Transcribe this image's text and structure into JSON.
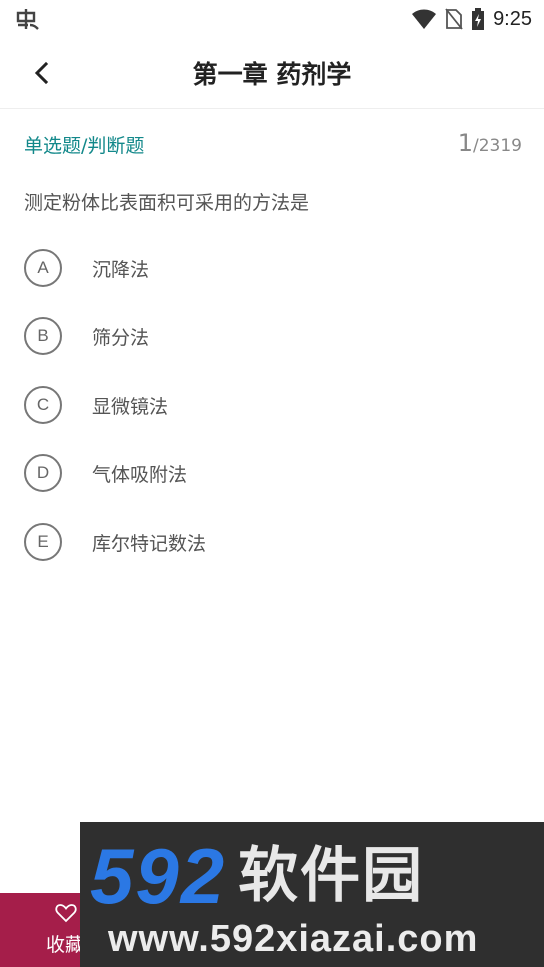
{
  "status_bar": {
    "time": "9:25",
    "icons": [
      "app-notification-icon",
      "wifi-icon",
      "no-sim-icon",
      "battery-charging-icon"
    ]
  },
  "header": {
    "title": "第一章 药剂学",
    "back_icon": "chevron-left-icon"
  },
  "question": {
    "type": "单选题/判断题",
    "index": "1",
    "total": "/2319",
    "text": "测定粉体比表面积可采用的方法是",
    "options": [
      {
        "letter": "A",
        "text": "沉降法"
      },
      {
        "letter": "B",
        "text": "筛分法"
      },
      {
        "letter": "C",
        "text": "显微镜法"
      },
      {
        "letter": "D",
        "text": "气体吸附法"
      },
      {
        "letter": "E",
        "text": "库尔特记数法"
      }
    ]
  },
  "footer": {
    "favorite_label": "收藏",
    "favorite_icon": "heart-outline-icon",
    "accent_color": "#a51e4a"
  },
  "watermark": {
    "digits": "592",
    "brand": "软件园",
    "url": "www.592xiazai.com"
  }
}
